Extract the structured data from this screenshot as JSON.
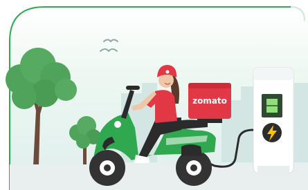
{
  "scene": {
    "brand_text": "zomato",
    "colors": {
      "card_border": "#2fa84f",
      "sky_top": "#eaf6ef",
      "sky_bottom": "#dfeeed",
      "tree_green": "#4fa35a",
      "tree_green_dark": "#2f7b3b",
      "scooter_green": "#2fa84f",
      "box_red": "#e23744",
      "rider_red": "#e23744",
      "station_body": "#ffffff",
      "station_screen": "#2e4b2f",
      "bolt_yellow": "#ffc400",
      "ground": "#e9eeee",
      "tire": "#333333"
    },
    "icons": [
      "bird-icon",
      "lightning-bolt-icon",
      "battery-icon"
    ]
  }
}
